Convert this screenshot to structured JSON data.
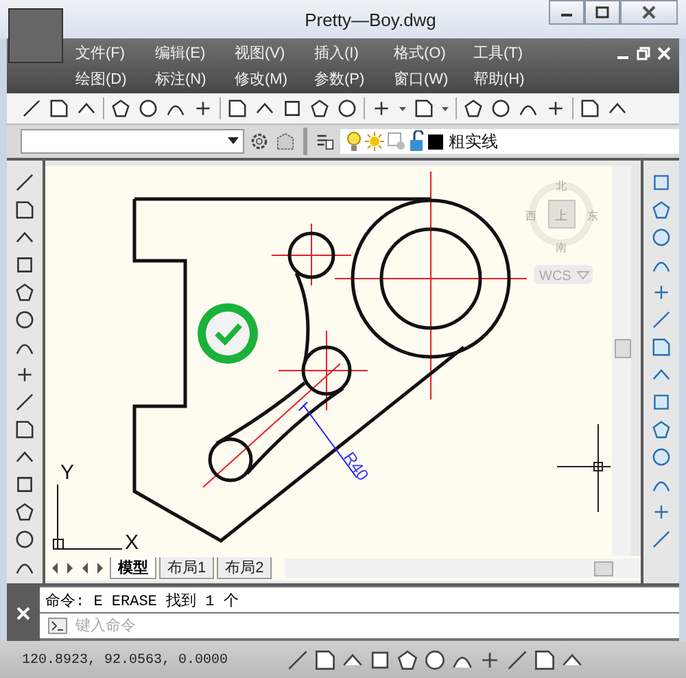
{
  "window": {
    "title": "Pretty—Boy.dwg"
  },
  "menu": [
    {
      "label": "文件(F)"
    },
    {
      "label": "编辑(E)"
    },
    {
      "label": "视图(V)"
    },
    {
      "label": "插入(I)"
    },
    {
      "label": "格式(O)"
    },
    {
      "label": "工具(T)"
    },
    {
      "label": "绘图(D)"
    },
    {
      "label": "标注(N)"
    },
    {
      "label": "修改(M)"
    },
    {
      "label": "参数(P)"
    },
    {
      "label": "窗口(W)"
    },
    {
      "label": "帮助(H)"
    }
  ],
  "layer": {
    "name": "粗实线"
  },
  "viewcube": {
    "north": "北",
    "west": "西",
    "east": "东",
    "south": "南",
    "face": "上",
    "ucs": "WCS"
  },
  "drawing": {
    "dimension": "R40"
  },
  "ucs_icon": {
    "x": "X",
    "y": "Y"
  },
  "layout_tabs": [
    {
      "label": "模型",
      "selected": true
    },
    {
      "label": "布局1",
      "selected": false
    },
    {
      "label": "布局2",
      "selected": false
    }
  ],
  "command": {
    "history": "命令: E ERASE 找到 1 个",
    "placeholder": "键入命令"
  },
  "status_bar": {
    "coordinates": "120.8923, 92.0563, 0.0000"
  }
}
